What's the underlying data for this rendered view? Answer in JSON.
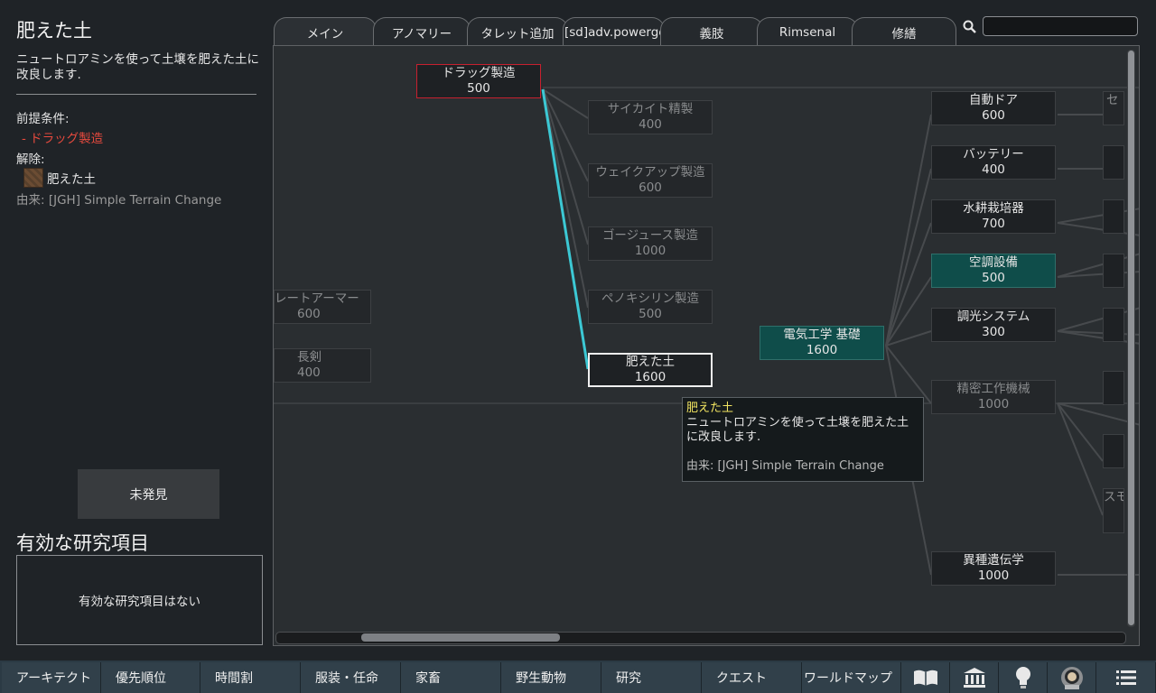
{
  "selected": {
    "title": "肥えた土",
    "description": "ニュートロアミンを使って土壌を肥えた土に改良します.",
    "prereq_header": "前提条件:",
    "prereq_item": " - ドラッグ製造",
    "unlock_header": "解除:",
    "unlock_item": "肥えた土",
    "source": "由来:  [JGH] Simple Terrain Change",
    "undiscovered_label": "未発見"
  },
  "active_research": {
    "header": "有効な研究項目",
    "empty": "有効な研究項目はない"
  },
  "tabs": [
    "メイン",
    "アノマリー",
    "タレット追加",
    "[sd]adv.powergen",
    "義肢",
    "Rimsenal",
    "修繕"
  ],
  "search": {
    "placeholder": "",
    "value": ""
  },
  "nodes": {
    "drug": {
      "label": "ドラッグ製造",
      "cost": "500"
    },
    "psychite": {
      "label": "サイカイト精製",
      "cost": "400"
    },
    "wakeup": {
      "label": "ウェイクアップ製造",
      "cost": "600"
    },
    "gojuice": {
      "label": "ゴージュース製造",
      "cost": "1000"
    },
    "penoxy": {
      "label": "ペノキシリン製造",
      "cost": "500"
    },
    "fertile": {
      "label": "肥えた土",
      "cost": "1600"
    },
    "plate": {
      "label": "レートアーマー",
      "cost": "600"
    },
    "longsword": {
      "label": "長剣",
      "cost": "400"
    },
    "electricity": {
      "label": "電気工学 基礎",
      "cost": "1600"
    },
    "autodoor": {
      "label": "自動ドア",
      "cost": "600"
    },
    "battery": {
      "label": "バッテリー",
      "cost": "400"
    },
    "hydro": {
      "label": "水耕栽培器",
      "cost": "700"
    },
    "aircon": {
      "label": "空調設備",
      "cost": "500"
    },
    "dimmer": {
      "label": "調光システム",
      "cost": "300"
    },
    "machining": {
      "label": "精密工作機械",
      "cost": "1000"
    },
    "xenogen": {
      "label": "異種遺伝学",
      "cost": "1000"
    },
    "edge1": {
      "label": "セ"
    },
    "edge2": {
      "label": "スモ"
    }
  },
  "tooltip": {
    "title": "肥えた土",
    "description": "ニュートロアミンを使って土壌を肥えた土に改良します.",
    "source": "由来: [JGH] Simple Terrain Change"
  },
  "bottom_bar": [
    "アーキテクト",
    "優先順位",
    "時間割",
    "服装・任命",
    "家畜",
    "野生動物",
    "研究",
    "クエスト",
    "ワールドマップ"
  ],
  "bottom_icons": [
    "book-icon",
    "museum-icon",
    "lightbulb-icon",
    "astronaut-icon",
    "menu-icon"
  ],
  "colors": {
    "prereq_red": "#e84a3e",
    "link_cyan": "#3cc8d4",
    "teal_node": "#0f4d4a",
    "tooltip_title": "#f1e461"
  }
}
